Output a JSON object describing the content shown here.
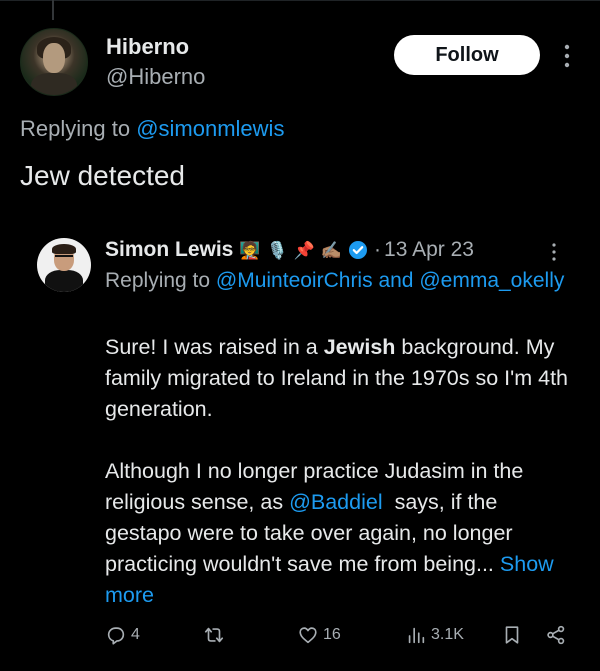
{
  "post": {
    "display_name": "Hiberno",
    "handle": "@Hiberno",
    "follow_label": "Follow",
    "replying_prefix": "Replying to",
    "replying_to": "@simonmlewis",
    "text": "Jew detected"
  },
  "quoted": {
    "name": "Simon Lewis",
    "emojis": [
      "🧑‍🏫",
      "🎙️",
      "📌",
      "✍🏽"
    ],
    "date_sep": "·",
    "date": "13 Apr 23",
    "replying_prefix": "Replying to",
    "replying_user1": "@MuinteoirChris",
    "replying_and": "and",
    "replying_user2": "@emma_okelly",
    "body1_a": "Sure! I was raised in a",
    "body1_bold": "Jewish",
    "body1_b": "background. My family migrated to Ireland in the 1970s so I'm 4th generation.",
    "body2_a": "Although I no longer practice Judasim in the religious sense, as",
    "body2_mention": "@Baddiel",
    "body2_b": "says, if the gestapo were to take over again, no longer practicing wouldn't save me from being...",
    "show_more": "Show more",
    "actions": {
      "replies": "4",
      "likes": "16",
      "views": "3.1K"
    }
  },
  "colors": {
    "background": "#000000",
    "text": "#e7e9ea",
    "secondary": "#a8aeb3",
    "accent": "#1d9bf0"
  }
}
